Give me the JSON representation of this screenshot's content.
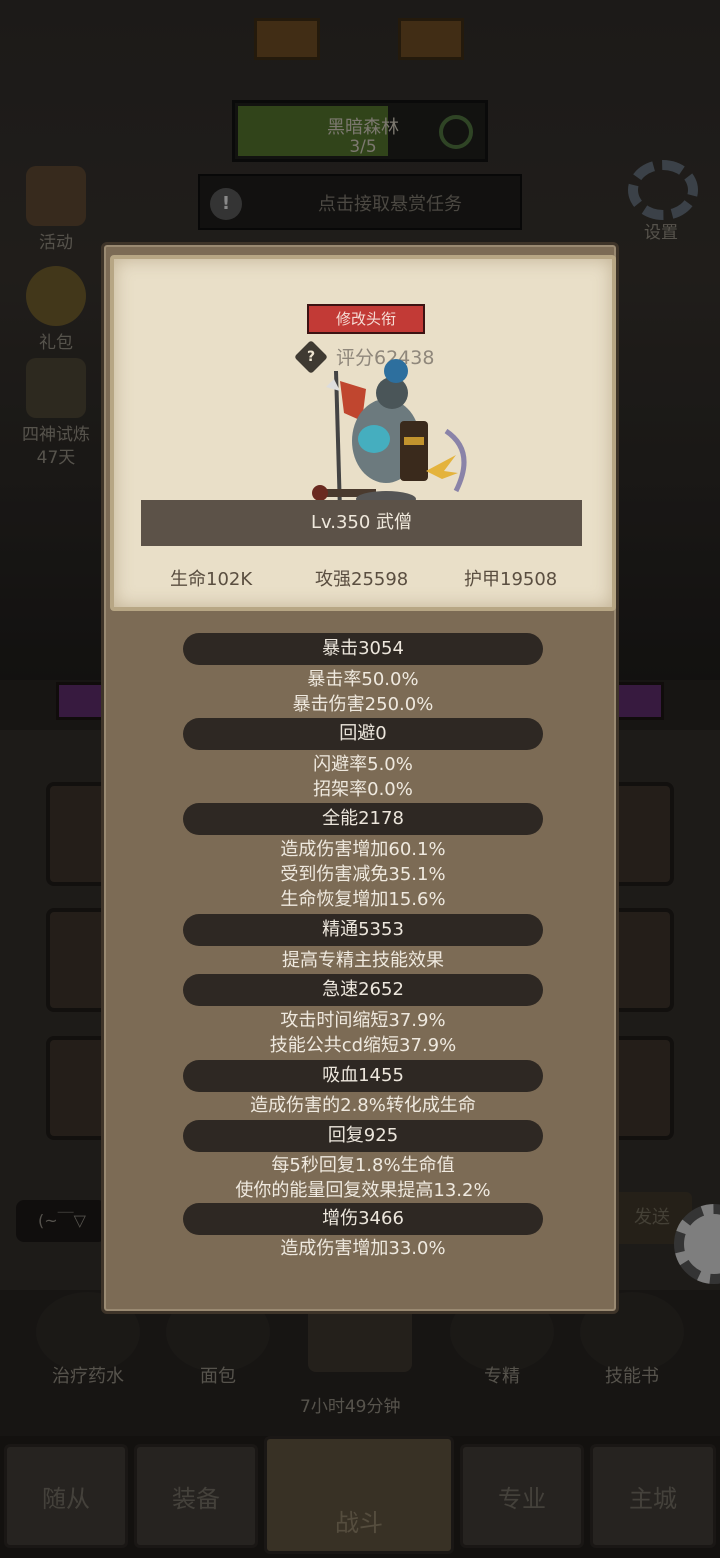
{
  "hud": {
    "map_name": "黑暗森林",
    "map_progress": "3/5",
    "quest_prompt": "点击接取悬赏任务",
    "quest_badge": "!",
    "side_left": [
      {
        "label": "活动"
      },
      {
        "label": "礼包"
      },
      {
        "label": "四神试炼",
        "sub": "47天"
      }
    ],
    "settings_label": "设置",
    "chat_placeholder": "(~￣▽",
    "send_label": "发送",
    "items": [
      {
        "label": "治疗药水"
      },
      {
        "label": "面包"
      },
      {
        "label": ""
      },
      {
        "label": "专精"
      },
      {
        "label": "技能书"
      }
    ],
    "chest_timer": "7小时49分钟"
  },
  "tabs": [
    {
      "label": "随从"
    },
    {
      "label": "装备"
    },
    {
      "label": "战斗"
    },
    {
      "label": "专业"
    },
    {
      "label": "主城"
    }
  ],
  "modal": {
    "rename_label": "修改头衔",
    "help_icon": "?",
    "score": "评分62438",
    "level_class": "Lv.350 武僧",
    "base_stats": [
      "生命102K",
      "攻强25598",
      "护甲19508"
    ],
    "sections": [
      {
        "title": "暴击3054",
        "lines": [
          "暴击率50.0%",
          "暴击伤害250.0%"
        ]
      },
      {
        "title": "回避0",
        "lines": [
          "闪避率5.0%",
          "招架率0.0%"
        ]
      },
      {
        "title": "全能2178",
        "lines": [
          "造成伤害增加60.1%",
          "受到伤害减免35.1%",
          "生命恢复增加15.6%"
        ]
      },
      {
        "title": "精通5353",
        "lines": [
          "提高专精主技能效果"
        ]
      },
      {
        "title": "急速2652",
        "lines": [
          "攻击时间缩短37.9%",
          "技能公共cd缩短37.9%"
        ]
      },
      {
        "title": "吸血1455",
        "lines": [
          "造成伤害的2.8%转化成生命"
        ]
      },
      {
        "title": "回复925",
        "lines": [
          "每5秒回复1.8%生命值",
          "使你的能量回复效果提高13.2%"
        ]
      },
      {
        "title": "增伤3466",
        "lines": [
          "造成伤害增加33.0%"
        ]
      }
    ]
  },
  "colors": {
    "modal_bg": "#7c6b55",
    "card_bg": "#e9dfc8",
    "rename_red": "#c23a36",
    "section_bar": "#2e2823"
  }
}
